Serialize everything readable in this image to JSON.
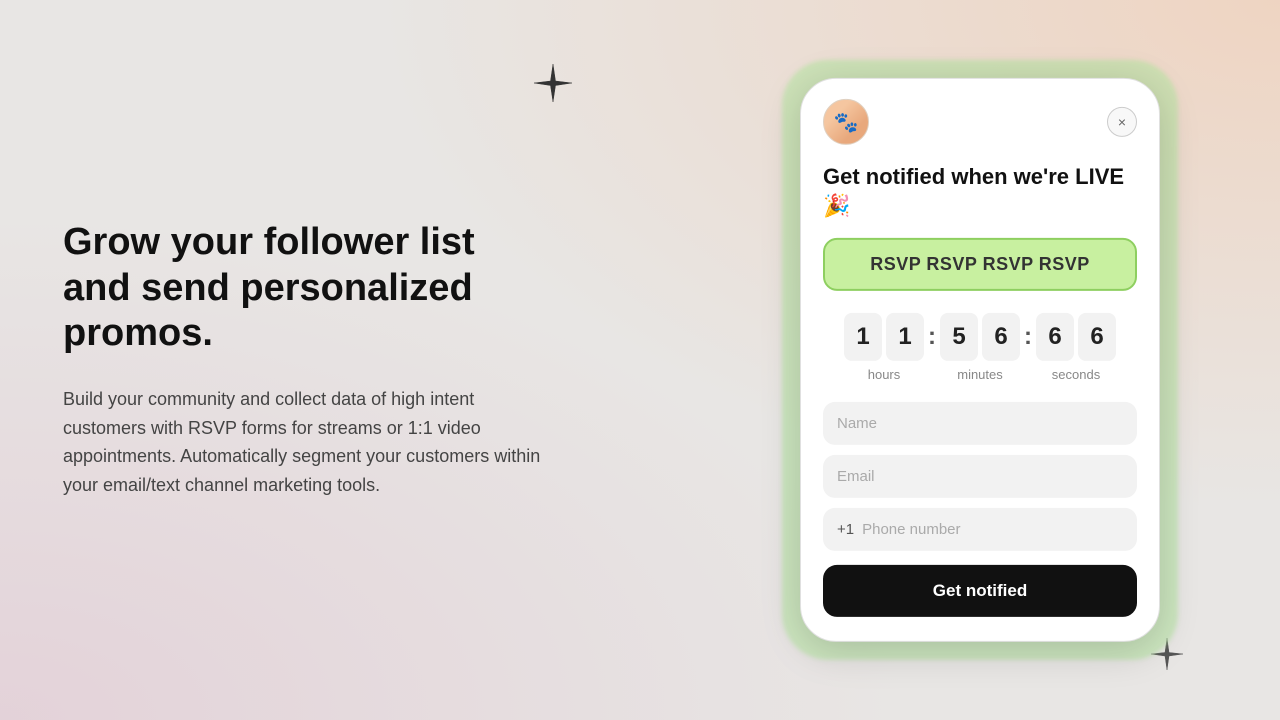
{
  "background": {
    "color": "#e8e6e4"
  },
  "left_panel": {
    "heading": "Grow your follower list and send personalized promos.",
    "body_text": "Build your community and collect data of high intent customers with RSVP forms for streams or 1:1 video appointments. Automatically segment your customers within your email/text channel marketing tools."
  },
  "decorations": {
    "star_top_label": "star-top",
    "star_bottom_label": "star-bottom"
  },
  "phone": {
    "avatar_emoji": "🐾",
    "close_label": "×",
    "notification_heading": "Get notified when we're LIVE 🎉",
    "rsvp_button_label": "RSVP RSVP RSVP RSVP",
    "countdown": {
      "hours": [
        "1",
        "1"
      ],
      "minutes": [
        "5",
        "6"
      ],
      "seconds": [
        "6",
        "6"
      ],
      "label_hours": "hours",
      "label_minutes": "minutes",
      "label_seconds": "seconds"
    },
    "form": {
      "name_placeholder": "Name",
      "email_placeholder": "Email",
      "phone_country_code": "+1",
      "phone_placeholder": "Phone number",
      "submit_label": "Get notified"
    }
  }
}
